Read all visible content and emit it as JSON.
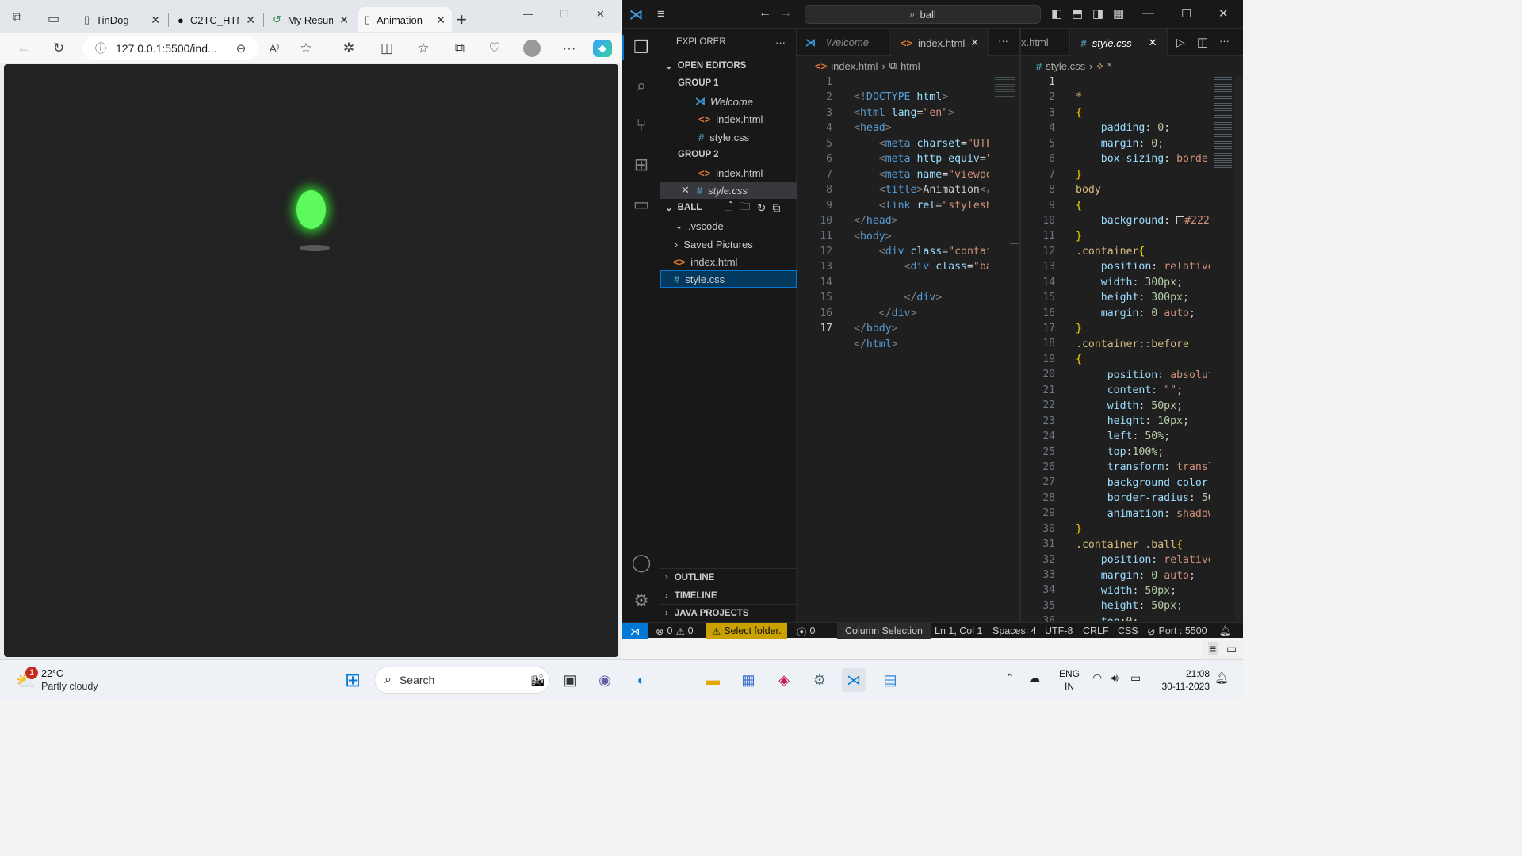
{
  "browser": {
    "tabs": [
      {
        "title": "TinDog",
        "close": "✕"
      },
      {
        "title": "C2TC_HTML",
        "close": "✕"
      },
      {
        "title": "My Resume",
        "close": "✕"
      },
      {
        "title": "Animation",
        "close": "✕"
      }
    ],
    "new_tab": "+",
    "address": "127.0.0.1:5500/ind...",
    "window_controls": [
      "—",
      "☐",
      "✕"
    ]
  },
  "vscode": {
    "search": "ball",
    "window_controls": [
      "—",
      "☐",
      "✕"
    ],
    "explorer": {
      "title": "EXPLORER",
      "more": "···",
      "open_editors": "OPEN EDITORS",
      "group1": "GROUP 1",
      "group1_items": [
        "Welcome",
        "index.html",
        "style.css"
      ],
      "group2": "GROUP 2",
      "group2_items": [
        "index.html",
        "style.css"
      ],
      "folder": "BALL",
      "folder_items": [
        ".vscode",
        "Saved Pictures",
        "index.html",
        "style.css"
      ],
      "outline": "OUTLINE",
      "timeline": "TIMELINE",
      "java_projects": "JAVA PROJECTS"
    },
    "left_tabs": [
      {
        "title": "Welcome"
      },
      {
        "title": "index.html"
      }
    ],
    "right_tabs": [
      {
        "title": "x.html"
      },
      {
        "title": "style.css"
      }
    ],
    "left_breadcrumb": [
      "index.html",
      "html"
    ],
    "right_breadcrumb": [
      "style.css",
      "*"
    ],
    "left_lines": [
      "1",
      "2",
      "3",
      "4",
      "5",
      "6",
      "7",
      "8",
      "9",
      "10",
      "11",
      "12",
      "13",
      "14",
      "15",
      "16",
      "17"
    ],
    "right_lines": [
      "1",
      "2",
      "3",
      "4",
      "5",
      "6",
      "7",
      "8",
      "9",
      "10",
      "11",
      "12",
      "13",
      "14",
      "15",
      "16",
      "17",
      "18",
      "19",
      "20",
      "21",
      "22",
      "23",
      "24",
      "25",
      "26",
      "27",
      "28",
      "29",
      "30",
      "31",
      "32",
      "33",
      "34",
      "35",
      "36"
    ],
    "status": {
      "errors": "0",
      "warnings": "0",
      "select_folder": "Select folder.",
      "ports": "0",
      "column_selection": "Column Selection",
      "position": "Ln 1, Col 1",
      "spaces": "Spaces: 4",
      "encoding": "UTF-8",
      "eol": "CRLF",
      "language": "CSS",
      "port": "Port : 5500"
    },
    "colors": {
      "accent": "#0078d4",
      "background": "#1f1f1f",
      "ball": "#5cfa5c"
    }
  },
  "taskbar": {
    "weather_temp": "22°C",
    "weather_desc": "Partly cloudy",
    "weather_badge": "1",
    "search": "Search",
    "lang_top": "ENG",
    "lang_bottom": "IN",
    "time": "21:08",
    "date": "30-11-2023"
  }
}
